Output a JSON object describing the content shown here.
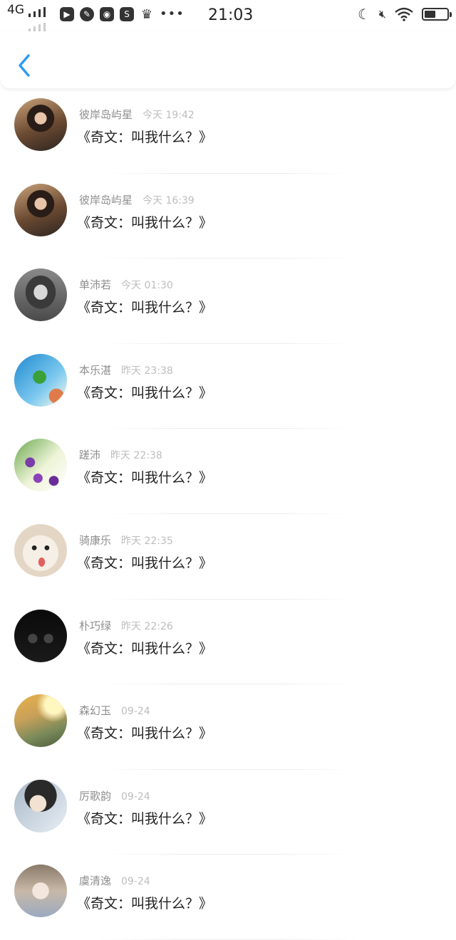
{
  "status_bar": {
    "network": "4G",
    "time": "21:03"
  },
  "comments": [
    {
      "username": "彼岸岛屿星",
      "timestamp": "今天 19:42",
      "text": "《奇文：叫我什么？》"
    },
    {
      "username": "彼岸岛屿星",
      "timestamp": "今天 16:39",
      "text": "《奇文：叫我什么？》"
    },
    {
      "username": "单沛若",
      "timestamp": "今天 01:30",
      "text": "《奇文：叫我什么？》"
    },
    {
      "username": "本乐湛",
      "timestamp": "昨天 23:38",
      "text": "《奇文：叫我什么？》"
    },
    {
      "username": "蹉沛",
      "timestamp": "昨天 22:38",
      "text": "《奇文：叫我什么？》"
    },
    {
      "username": "骑康乐",
      "timestamp": "昨天 22:35",
      "text": "《奇文：叫我什么？》"
    },
    {
      "username": "朴巧绿",
      "timestamp": "昨天 22:26",
      "text": "《奇文：叫我什么？》"
    },
    {
      "username": "森幻玉",
      "timestamp": "09-24",
      "text": "《奇文：叫我什么？》"
    },
    {
      "username": "厉歌韵",
      "timestamp": "09-24",
      "text": "《奇文：叫我什么？》"
    },
    {
      "username": "虞清逸",
      "timestamp": "09-24",
      "text": "《奇文：叫我什么？》"
    }
  ],
  "colors": {
    "accent": "#2b9bf4",
    "username": "#8e8e8e",
    "timestamp": "#bdbdbd"
  }
}
